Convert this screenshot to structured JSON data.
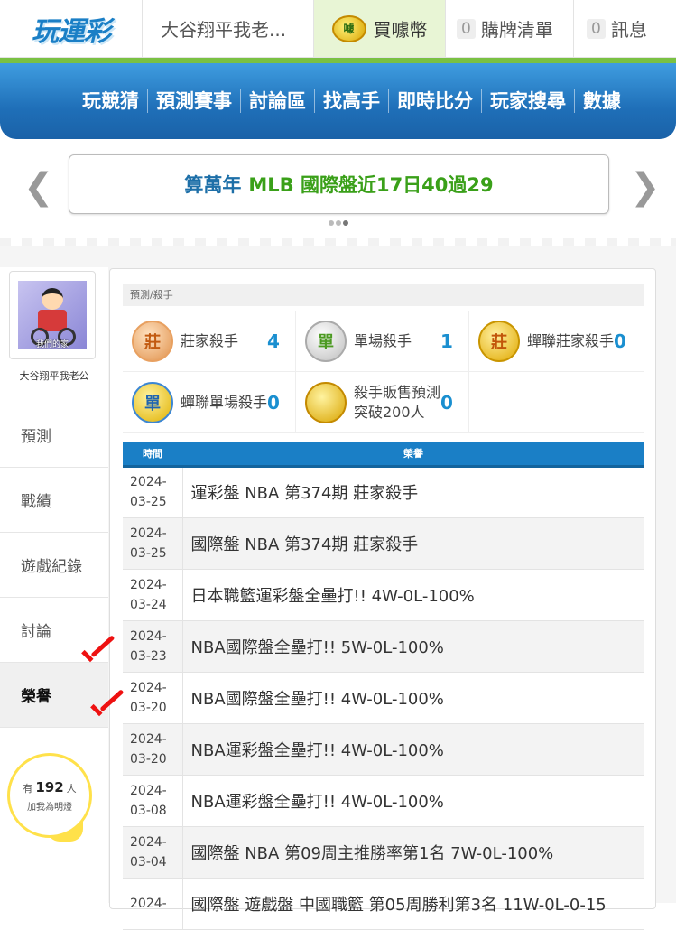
{
  "header": {
    "logo": "玩運彩",
    "user_name": "大谷翔平我老...",
    "buy_label": "買噱幣",
    "coin_icon_text": "噱",
    "cart_count": "0",
    "cart_label": "購牌清單",
    "msg_count": "0",
    "msg_label": "訊息"
  },
  "nav": [
    "玩競猜",
    "預測賽事",
    "討論區",
    "找高手",
    "即時比分",
    "玩家搜尋",
    "數據"
  ],
  "ticker": {
    "blue": "算萬年",
    "green": "MLB 國際盤近17日40過29"
  },
  "sidebar": {
    "avatar_caption": "我們的家",
    "user_name": "大谷翔平我老公",
    "menu": [
      "預測",
      "戰績",
      "遊戲紀錄",
      "討論",
      "榮譽"
    ],
    "active_index": 4,
    "bulb": {
      "prefix": "有",
      "count": "192",
      "suffix": "人",
      "line2": "加我為明燈"
    }
  },
  "main": {
    "breadcrumb": "預測/殺手",
    "badges": [
      {
        "icon": "莊",
        "label": "莊家殺手",
        "count": "4",
        "style": "bronze"
      },
      {
        "icon": "單",
        "label": "單場殺手",
        "count": "1",
        "style": "silver"
      },
      {
        "icon": "莊",
        "label": "蟬聯莊家殺手",
        "count": "0",
        "style": "gold"
      },
      {
        "icon": "單",
        "label": "蟬聯單場殺手",
        "count": "0",
        "style": "blue"
      },
      {
        "icon": "",
        "label": "殺手販售預測突破200人",
        "count": "0",
        "style": "coin2"
      }
    ],
    "table": {
      "headers": [
        "時間",
        "榮譽"
      ],
      "rows": [
        {
          "date_y": "2024-",
          "date_md": "03-25",
          "honor": "運彩盤 NBA 第374期 莊家殺手"
        },
        {
          "date_y": "2024-",
          "date_md": "03-25",
          "honor": "國際盤 NBA 第374期 莊家殺手"
        },
        {
          "date_y": "2024-",
          "date_md": "03-24",
          "honor": "日本職籃運彩盤全壘打!! 4W-0L-100%"
        },
        {
          "date_y": "2024-",
          "date_md": "03-23",
          "honor": "NBA國際盤全壘打!! 5W-0L-100%"
        },
        {
          "date_y": "2024-",
          "date_md": "03-20",
          "honor": "NBA國際盤全壘打!! 4W-0L-100%"
        },
        {
          "date_y": "2024-",
          "date_md": "03-20",
          "honor": "NBA運彩盤全壘打!! 4W-0L-100%"
        },
        {
          "date_y": "2024-",
          "date_md": "03-08",
          "honor": "NBA運彩盤全壘打!! 4W-0L-100%"
        },
        {
          "date_y": "2024-",
          "date_md": "03-04",
          "honor": "國際盤 NBA 第09周主推勝率第1名 7W-0L-100%"
        },
        {
          "date_y": "2024-",
          "date_md": "",
          "honor": "國際盤 遊戲盤 中國職籃 第05周勝利第3名 11W-0L-0-15"
        }
      ]
    }
  },
  "colors": {
    "brand_blue": "#1a7fc6",
    "accent_green": "#7ac143",
    "check_red": "#e11"
  }
}
